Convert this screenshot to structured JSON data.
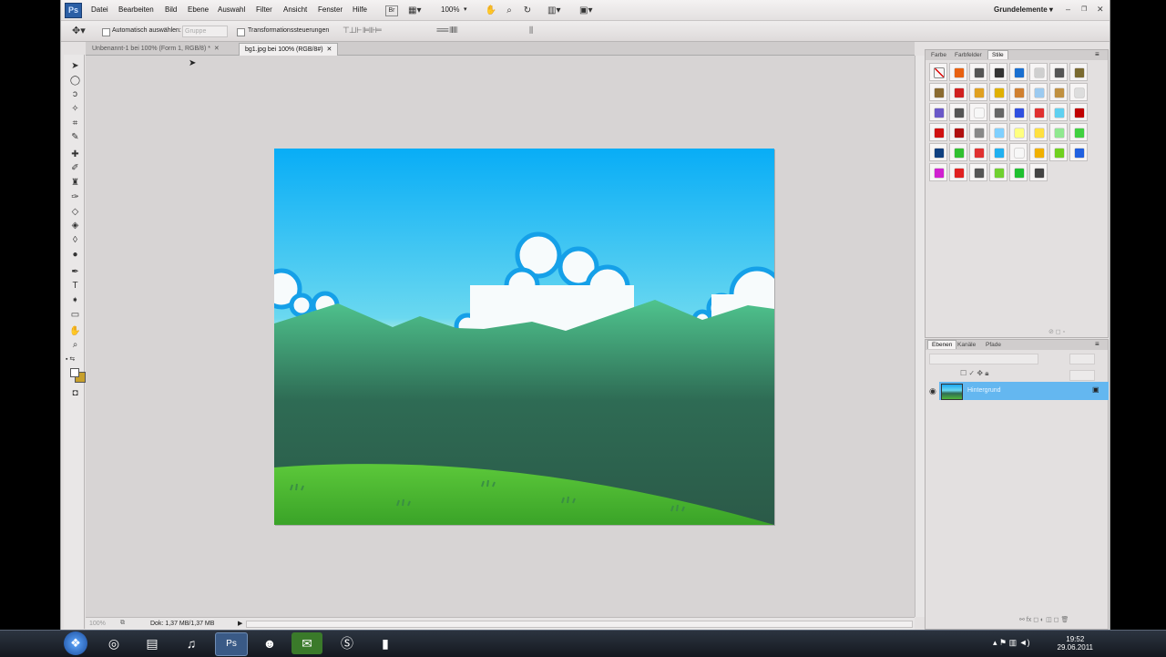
{
  "app": {
    "logo": "Ps"
  },
  "menu": {
    "items": [
      "Datei",
      "Bearbeiten",
      "Bild",
      "Ebene",
      "Auswahl",
      "Filter",
      "Ansicht",
      "Fenster",
      "Hilfe"
    ],
    "zoom": "100%",
    "workspace": "Grundelemente"
  },
  "options": {
    "auto_select_label": "Automatisch auswählen:",
    "auto_select_value": "Gruppe",
    "transform_label": "Transformationssteuerungen"
  },
  "tabs": [
    {
      "label": "Unbenannt-1 bei 100% (Form 1, RGB/8) *",
      "active": false
    },
    {
      "label": "bg1.jpg bei 100% (RGB/8#)",
      "active": true
    }
  ],
  "status": {
    "zoom": "100%",
    "doc": "Dok: 1,37 MB/1,37 MB"
  },
  "styles_panel": {
    "tabs": [
      "Farbe",
      "Farbfelder",
      "Stile"
    ],
    "active_tab": "Stile"
  },
  "layers_panel": {
    "tabs": [
      "Ebenen",
      "Kanäle",
      "Pfade"
    ],
    "active_tab": "Ebenen",
    "layer_name": "Hintergrund"
  },
  "taskbar": {
    "time": "19:52",
    "date": "29.06.2011"
  },
  "colors": {
    "sky_top": "#0ab0f5",
    "sky_bottom": "#baf2dc",
    "mountain": "#2e5d4a",
    "grass": "#56c53b",
    "cloud_outline": "#15a0e8",
    "selected_layer": "#64b7f0"
  }
}
